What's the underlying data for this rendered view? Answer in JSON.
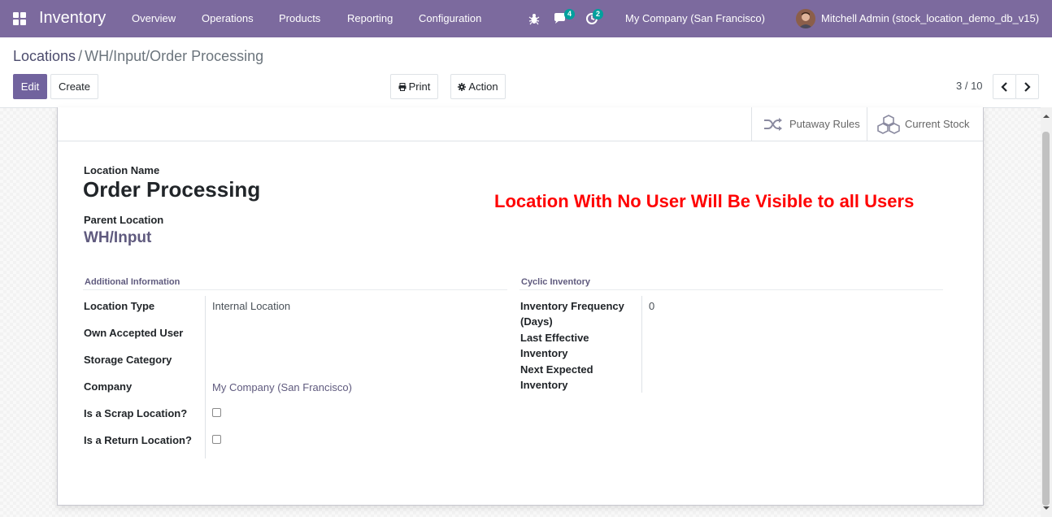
{
  "navbar": {
    "brand": "Inventory",
    "menu": [
      "Overview",
      "Operations",
      "Products",
      "Reporting",
      "Configuration"
    ],
    "messages_count": "4",
    "activities_count": "2",
    "company": "My Company (San Francisco)",
    "user": "Mitchell Admin (stock_location_demo_db_v15)"
  },
  "breadcrumb": {
    "parent": "Locations",
    "separator": "/",
    "current": "WH/Input/Order Processing"
  },
  "toolbar": {
    "edit_label": "Edit",
    "create_label": "Create",
    "print_label": "Print",
    "action_label": "Action",
    "pager": "3 / 10"
  },
  "smart_buttons": {
    "putaway_label": "Putaway Rules",
    "stock_label": "Current Stock"
  },
  "form": {
    "location_name_label": "Location Name",
    "location_name": "Order Processing",
    "parent_location_label": "Parent Location",
    "parent_location": "WH/Input",
    "annotation": "Location With No User Will Be Visible to all Users",
    "additional_info_title": "Additional Information",
    "cyclic_inventory_title": "Cyclic Inventory",
    "fields_left": [
      {
        "label": "Location Type",
        "value": "Internal Location"
      },
      {
        "label": "Own Accepted User",
        "value": ""
      },
      {
        "label": "Storage Category",
        "value": ""
      },
      {
        "label": "Company",
        "value": "My Company (San Francisco)"
      },
      {
        "label": "Is a Scrap Location?",
        "value": ""
      },
      {
        "label": "Is a Return Location?",
        "value": ""
      }
    ],
    "inventory_frequency_label_1": "Inventory Frequency",
    "inventory_frequency_label_2": "(Days)",
    "inventory_frequency": "0",
    "last_effective_label_1": "Last Effective",
    "last_effective_label_2": "Inventory",
    "next_expected_label_1": "Next Expected",
    "next_expected_label_2": "Inventory"
  },
  "colors": {
    "navbar": "#7c6a9e",
    "primary": "#71639e",
    "annotation": "#ff0000",
    "badge": "#00a09d"
  }
}
